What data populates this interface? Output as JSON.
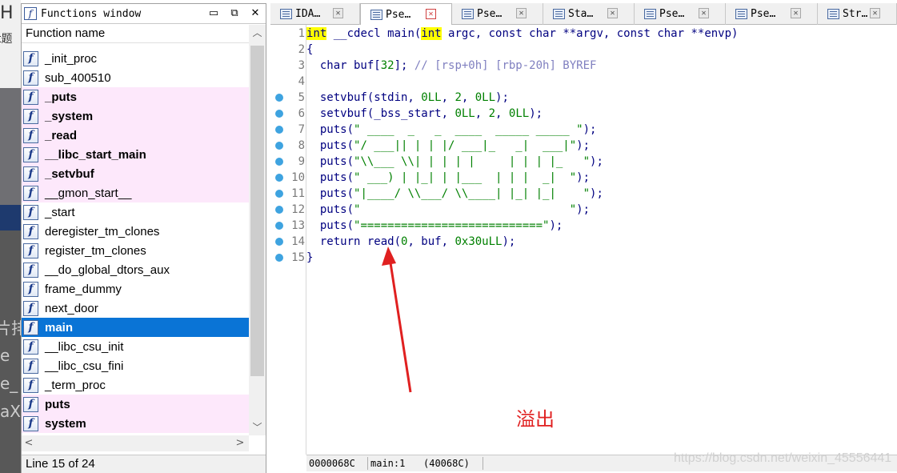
{
  "background": {
    "left_fragments": [
      "H",
      "t题",
      "片排",
      "e",
      "e_",
      "aX"
    ]
  },
  "functions_window": {
    "title": "Functions window",
    "column_header": "Function name",
    "items": [
      {
        "name": "_init_proc",
        "style": "normal"
      },
      {
        "name": "sub_400510",
        "style": "normal"
      },
      {
        "name": "_puts",
        "style": "pink-bold"
      },
      {
        "name": "_system",
        "style": "pink-bold"
      },
      {
        "name": "_read",
        "style": "pink-bold"
      },
      {
        "name": "__libc_start_main",
        "style": "pink-bold"
      },
      {
        "name": "_setvbuf",
        "style": "pink-bold"
      },
      {
        "name": "__gmon_start__",
        "style": "pink"
      },
      {
        "name": "_start",
        "style": "normal"
      },
      {
        "name": "deregister_tm_clones",
        "style": "normal"
      },
      {
        "name": "register_tm_clones",
        "style": "normal"
      },
      {
        "name": "__do_global_dtors_aux",
        "style": "normal"
      },
      {
        "name": "frame_dummy",
        "style": "normal"
      },
      {
        "name": "next_door",
        "style": "normal"
      },
      {
        "name": "main",
        "style": "selected"
      },
      {
        "name": "__libc_csu_init",
        "style": "normal"
      },
      {
        "name": "__libc_csu_fini",
        "style": "normal"
      },
      {
        "name": "_term_proc",
        "style": "normal"
      },
      {
        "name": "puts",
        "style": "pink-bold"
      },
      {
        "name": "system",
        "style": "pink-bold"
      }
    ],
    "status": "Line 15 of 24"
  },
  "tabs": [
    {
      "label": "IDA…",
      "active": false
    },
    {
      "label": "Pse…",
      "active": true
    },
    {
      "label": "Pse…",
      "active": false
    },
    {
      "label": "Sta…",
      "active": false
    },
    {
      "label": "Pse…",
      "active": false
    },
    {
      "label": "Pse…",
      "active": false
    },
    {
      "label": "Str…",
      "active": false
    }
  ],
  "code": {
    "lines": [
      {
        "n": "1",
        "bp": false,
        "text": "int __cdecl main(int argc, const char **argv, const char **envp)"
      },
      {
        "n": "2",
        "bp": false,
        "text": "{"
      },
      {
        "n": "3",
        "bp": false,
        "text": "  char buf[32]; // [rsp+0h] [rbp-20h] BYREF"
      },
      {
        "n": "4",
        "bp": false,
        "text": ""
      },
      {
        "n": "5",
        "bp": true,
        "text": "  setvbuf(stdin, 0LL, 2, 0LL);"
      },
      {
        "n": "6",
        "bp": true,
        "text": "  setvbuf(_bss_start, 0LL, 2, 0LL);"
      },
      {
        "n": "7",
        "bp": true,
        "text": "  puts(\" ____  _   _  ____  _____ _____ \");"
      },
      {
        "n": "8",
        "bp": true,
        "text": "  puts(\"/ ___|| | | |/ ___|_   _|  ___|\");"
      },
      {
        "n": "9",
        "bp": true,
        "text": "  puts(\"\\\\___ \\\\| | | | |     | | | |_   \");"
      },
      {
        "n": "10",
        "bp": true,
        "text": "  puts(\" ___) | |_| | |___  | | |  _|  \");"
      },
      {
        "n": "11",
        "bp": true,
        "text": "  puts(\"|____/ \\\\___/ \\\\____| |_| |_|    \");"
      },
      {
        "n": "12",
        "bp": true,
        "text": "  puts(\"                               \");"
      },
      {
        "n": "13",
        "bp": true,
        "text": "  puts(\"===========================\");"
      },
      {
        "n": "14",
        "bp": true,
        "text": "  return read(0, buf, 0x30uLL);"
      },
      {
        "n": "15",
        "bp": true,
        "text": "}"
      }
    ],
    "highlight_word": "int"
  },
  "code_status": {
    "address": "0000068C",
    "location": "main:1",
    "offset": "(40068C)"
  },
  "annotation": {
    "label": "溢出",
    "color": "#e02020"
  },
  "watermark": "https://blog.csdn.net/weixin_45556441",
  "colors": {
    "selection": "#0a74d6",
    "imported_row": "#fde8fb",
    "breakpoint": "#3ea3e0",
    "string_literal": "#008000",
    "identifier": "#000080",
    "comment": "#8080c0"
  }
}
